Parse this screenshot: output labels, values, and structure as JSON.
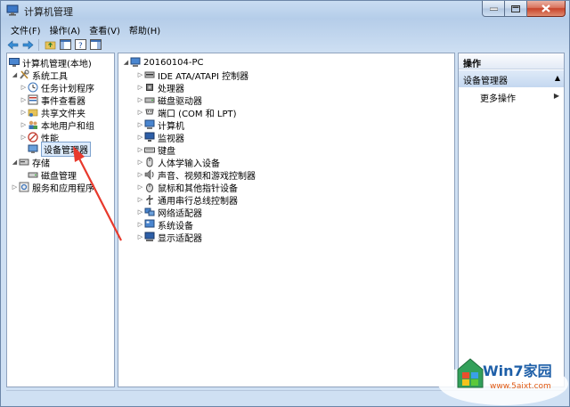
{
  "window": {
    "title": "计算机管理"
  },
  "menu": [
    "文件(F)",
    "操作(A)",
    "查看(V)",
    "帮助(H)"
  ],
  "left_tree": {
    "root": "计算机管理(本地)",
    "system_tools": "系统工具",
    "task_scheduler": "任务计划程序",
    "event_viewer": "事件查看器",
    "shared_folders": "共享文件夹",
    "local_users": "本地用户和组",
    "performance": "性能",
    "device_manager": "设备管理器",
    "storage": "存储",
    "disk_management": "磁盘管理",
    "services": "服务和应用程序"
  },
  "device_tree": {
    "computer_name": "20160104-PC",
    "categories": [
      "IDE ATA/ATAPI 控制器",
      "处理器",
      "磁盘驱动器",
      "端口 (COM 和 LPT)",
      "计算机",
      "监视器",
      "键盘",
      "人体学输入设备",
      "声音、视频和游戏控制器",
      "鼠标和其他指针设备",
      "通用串行总线控制器",
      "网络适配器",
      "系统设备",
      "显示适配器"
    ]
  },
  "actions": {
    "header": "操作",
    "section": "设备管理器",
    "more": "更多操作"
  },
  "watermark": {
    "brand": "Win7家园",
    "url": "www.5aixt.com"
  },
  "colors": {
    "annotation_arrow": "#e8392c",
    "selection": "#dcebfc",
    "accent": "#1e5fa8"
  }
}
